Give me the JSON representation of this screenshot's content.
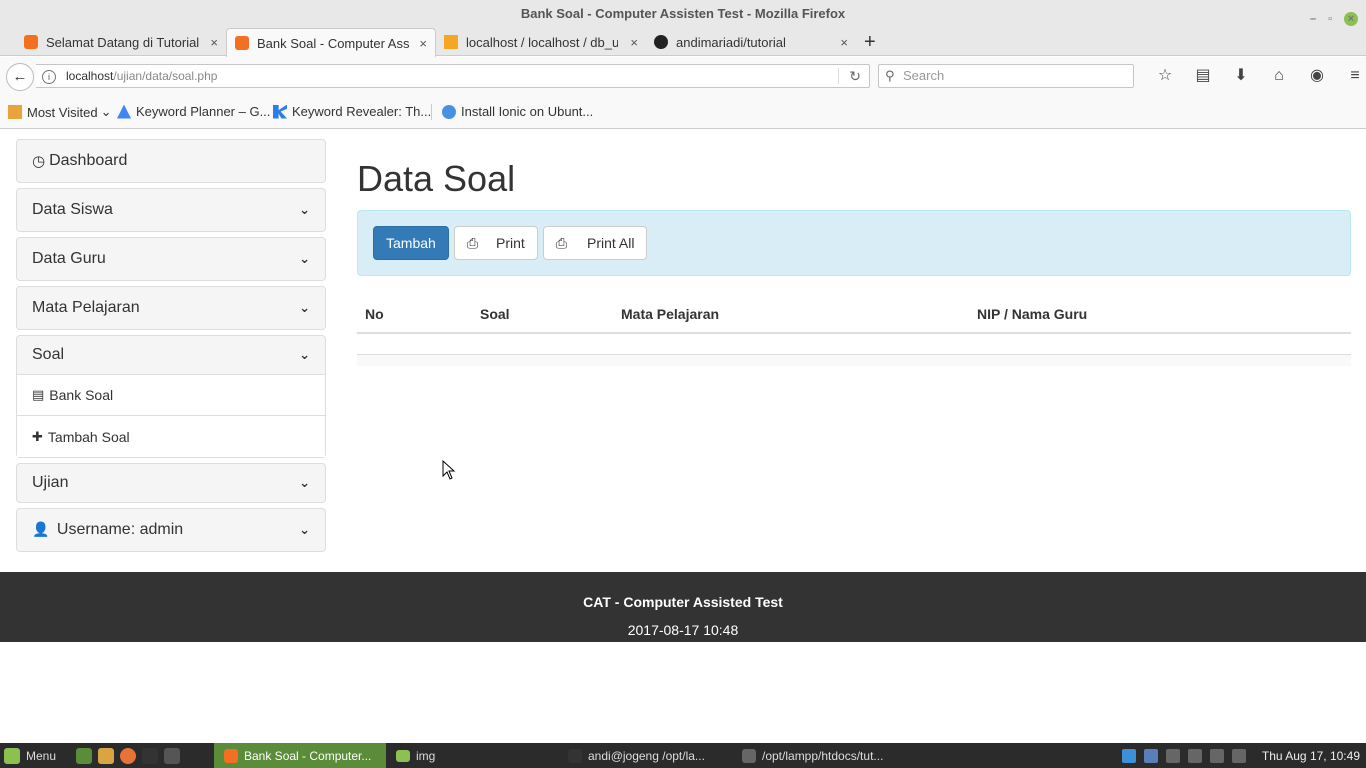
{
  "window": {
    "title": "Bank Soal - Computer Assisten Test - Mozilla Firefox"
  },
  "tabs": [
    {
      "label": "Selamat Datang di Tutorial",
      "icon": "xampp-icon"
    },
    {
      "label": "Bank Soal - Computer Assis",
      "icon": "xampp-icon",
      "active": true
    },
    {
      "label": "localhost / localhost / db_uji",
      "icon": "phpmyadmin-icon"
    },
    {
      "label": "andimariadi/tutorial",
      "icon": "github-icon"
    }
  ],
  "toolbar": {
    "url_host": "localhost",
    "url_path": "/ujian/data/soal.php",
    "search_placeholder": "Search",
    "back_glyph": "←",
    "reload_glyph": "↻",
    "info_glyph": "i",
    "search_glyph": "⚲",
    "icons": [
      "☆",
      "▤",
      "⬇",
      "⌂",
      "◉",
      "≡"
    ],
    "newtab_glyph": "+",
    "tab_close_glyph": "×"
  },
  "bookmarks": [
    {
      "label": "Most Visited",
      "color": "#e8a33b",
      "suffix": "⌄"
    },
    {
      "label": "Keyword Planner – G...",
      "color": "#4285f4"
    },
    {
      "label": "Keyword Revealer: Th...",
      "color": "#2b7de9"
    },
    {
      "label": "Install Ionic on Ubunt...",
      "color": "#4a90e2"
    }
  ],
  "sidebar": {
    "dashboard": {
      "label": "Dashboard",
      "glyph": "◷"
    },
    "sections": [
      {
        "label": "Data Siswa"
      },
      {
        "label": "Data Guru"
      },
      {
        "label": "Mata Pelajaran"
      },
      {
        "label": "Soal",
        "items": [
          {
            "label": "Bank Soal",
            "glyph": "▤"
          },
          {
            "label": "Tambah Soal",
            "glyph": "✚"
          }
        ]
      },
      {
        "label": "Ujian"
      }
    ],
    "user": {
      "label": "Username: admin",
      "glyph": "👤"
    },
    "chevron": "⌄"
  },
  "main": {
    "title": "Data Soal",
    "buttons": {
      "add": "Tambah",
      "print": "Print",
      "print_all": "Print All",
      "print_glyph": "⎙"
    },
    "table": {
      "headers": [
        "No",
        "Soal",
        "Mata Pelajaran",
        "NIP / Nama Guru"
      ],
      "rows": []
    }
  },
  "footer": {
    "title": "CAT - Computer Assisted Test",
    "datetime": "2017-08-17 10:48"
  },
  "taskbar": {
    "menu": "Menu",
    "items": [
      {
        "label": "Bank Soal - Computer...",
        "active": true
      },
      {
        "label": "img"
      },
      {
        "label": "andi@jogeng /opt/la..."
      },
      {
        "label": "/opt/lampp/htdocs/tut..."
      }
    ],
    "clock": "Thu Aug 17, 10:49"
  },
  "colors": {
    "primary": "#337ab7",
    "alert_bg": "#d9edf7",
    "footer_bg": "#333333",
    "taskbar_active": "#5b8c3a"
  }
}
